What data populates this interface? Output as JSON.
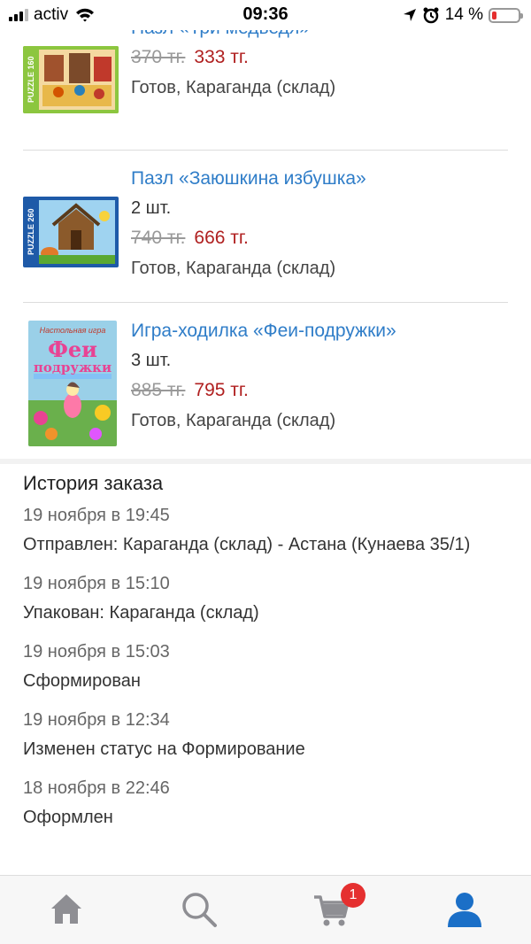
{
  "status_bar": {
    "carrier": "activ",
    "time": "09:36",
    "battery": "14 %"
  },
  "products": [
    {
      "title": "Пазл «Три медведя»",
      "old_price": "370 тг.",
      "new_price": "333 тг.",
      "stock": "Готов, Караганда (склад)"
    },
    {
      "title": "Пазл «Заюшкина избушка»",
      "qty": "2 шт.",
      "old_price": "740 тг.",
      "new_price": "666 тг.",
      "stock": "Готов, Караганда (склад)"
    },
    {
      "title": "Игра-ходилка «Феи-подружки»",
      "qty": "3 шт.",
      "old_price": "885 тг.",
      "new_price": "795 тг.",
      "stock": "Готов, Караганда (склад)"
    }
  ],
  "thumbs": {
    "p1_label": "PUZZLE 160",
    "p2_label": "PUZZLE 260",
    "p3_top": "Настольная игра",
    "p3_title_1": "Феи",
    "p3_title_2": "подружки"
  },
  "history": {
    "title": "История заказа",
    "entries": [
      {
        "date": "19 ноября в 19:45",
        "text": "Отправлен: Караганда (склад) - Астана (Кунаева 35/1)"
      },
      {
        "date": "19 ноября в 15:10",
        "text": "Упакован: Караганда (склад)"
      },
      {
        "date": "19 ноября в 15:03",
        "text": "Сформирован"
      },
      {
        "date": "19 ноября в 12:34",
        "text": "Изменен статус на Формирование"
      },
      {
        "date": "18 ноября в 22:46",
        "text": "Оформлен"
      }
    ]
  },
  "tab_bar": {
    "cart_badge": "1",
    "icons": [
      "home-icon",
      "search-icon",
      "cart-icon",
      "profile-icon"
    ],
    "inactive_color": "#8e8e93",
    "active_color": "#1b6fc7"
  }
}
